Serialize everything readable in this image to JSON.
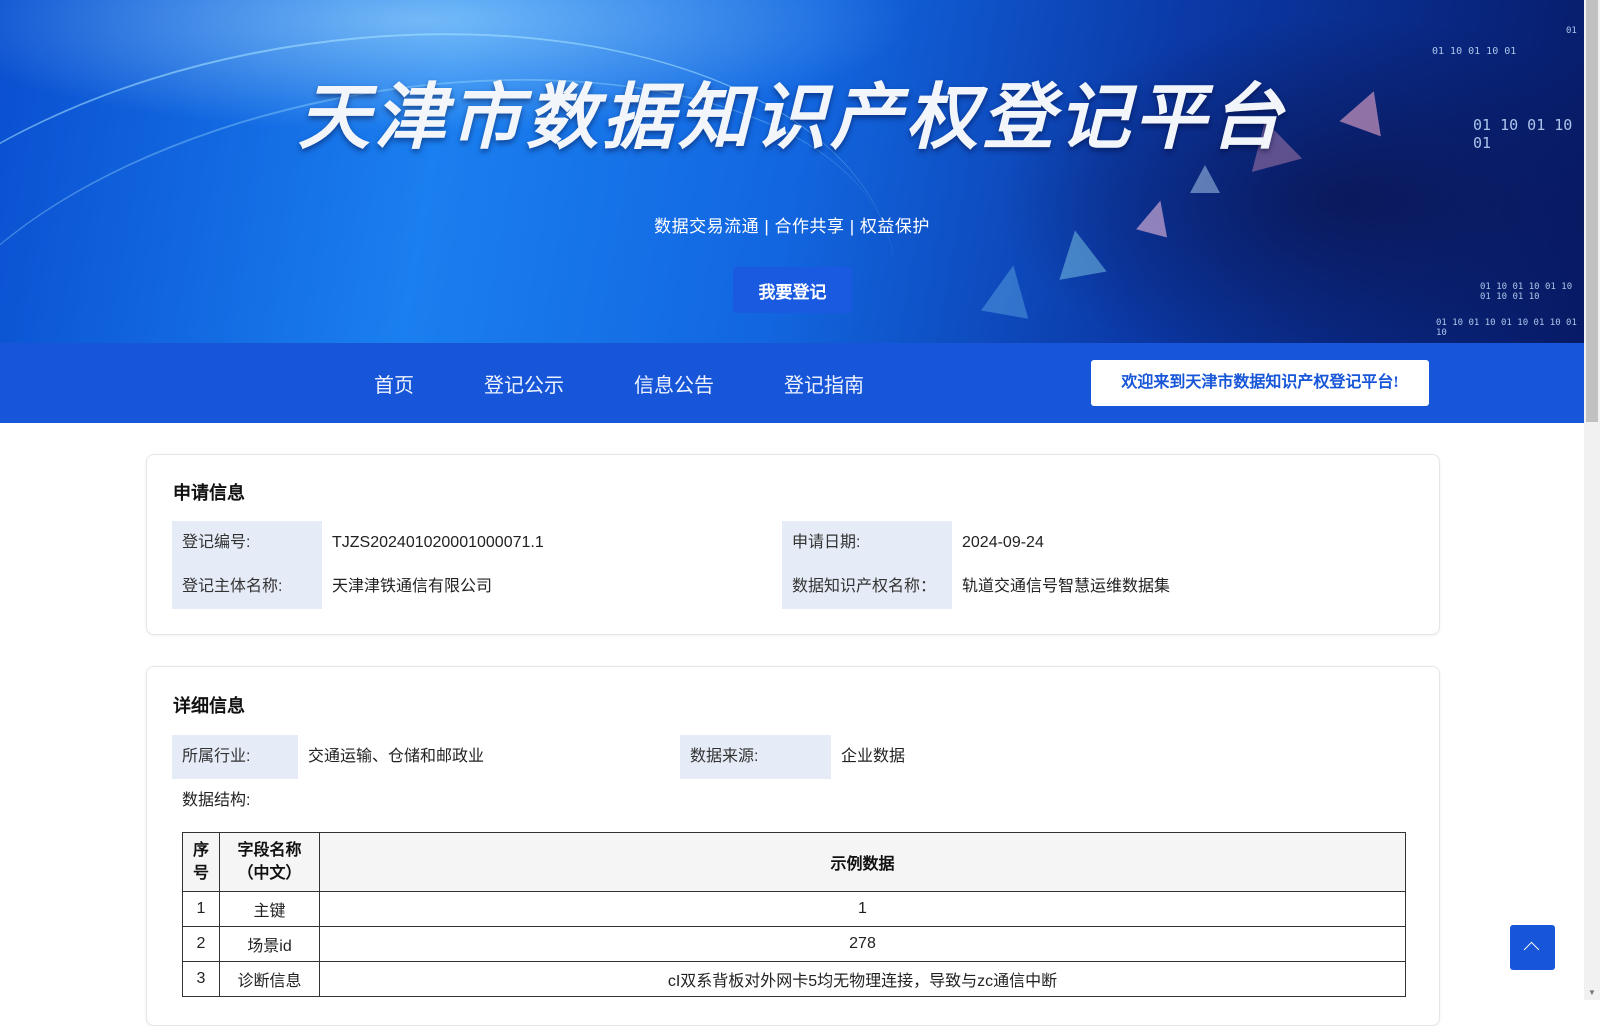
{
  "banner": {
    "title": "天津市数据知识产权登记平台",
    "subtitle": "数据交易流通 | 合作共享 | 权益保护",
    "register_button": "我要登记",
    "binary_1": "01 10 01 10 01",
    "binary_2": "01 10 01 10 01 10 01 10 01",
    "binary_3": "01 10 01 10 01 10 01 10 01 10",
    "binary_4": "01 10 01 10 01 10 01 10 01 10",
    "binary_5": "01"
  },
  "nav": {
    "items": [
      "首页",
      "登记公示",
      "信息公告",
      "登记指南"
    ],
    "welcome": "欢迎来到天津市数据知识产权登记平台!"
  },
  "application": {
    "title": "申请信息",
    "reg_no_label": "登记编号:",
    "reg_no": "TJZS202401020001000071.1",
    "apply_date_label": "申请日期:",
    "apply_date": "2024-09-24",
    "subject_label": "登记主体名称:",
    "subject": "天津津铁通信有限公司",
    "ip_name_label": "数据知识产权名称：",
    "ip_name": "轨道交通信号智慧运维数据集"
  },
  "detail": {
    "title": "详细信息",
    "industry_label": "所属行业:",
    "industry": "交通运输、仓储和邮政业",
    "source_label": "数据来源:",
    "source": "企业数据",
    "structure_label": "数据结构:",
    "table": {
      "headers": [
        "序号",
        "字段名称（中文）",
        "示例数据"
      ],
      "rows": [
        [
          "1",
          "主键",
          "1"
        ],
        [
          "2",
          "场景id",
          "278"
        ],
        [
          "3",
          "诊断信息",
          "cI双系背板对外网卡5均无物理连接，导致与zc通信中断"
        ]
      ]
    }
  },
  "colors": {
    "primary": "#1756d8",
    "label_bg": "#e6ecf7"
  },
  "icons": {
    "back_to_top": "chevron-up-icon"
  }
}
